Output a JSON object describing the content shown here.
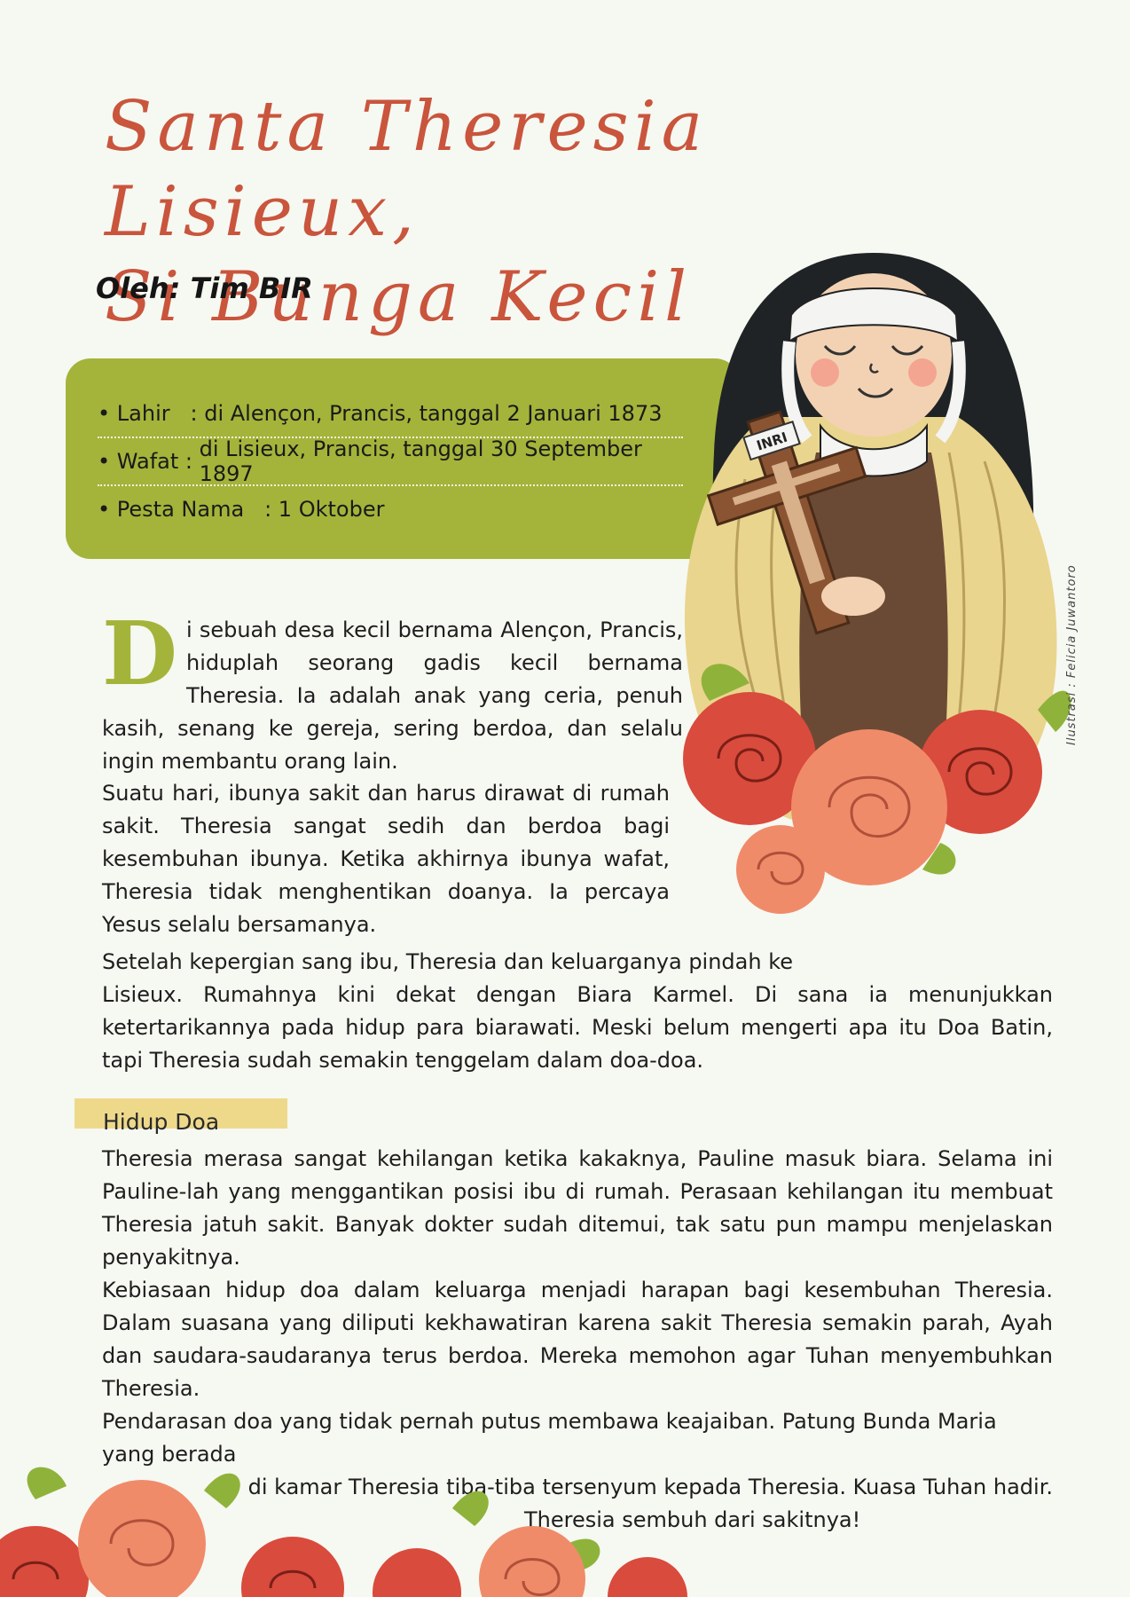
{
  "title_lines": [
    "Santa Theresia Lisieux,",
    "Si Bunga Kecil"
  ],
  "byline": "Oleh: Tim BIR",
  "info": [
    {
      "label": "Lahir",
      "sep": "   : ",
      "value": "di Alençon, Prancis, tanggal 2 Januari 1873"
    },
    {
      "label": "Wafat",
      "sep": " : ",
      "value": "di Lisieux, Prancis, tanggal 30 September 1897"
    },
    {
      "label": "Pesta Nama",
      "sep": "   : ",
      "value": "1 Oktober"
    }
  ],
  "illustration": {
    "credit": "Ilustrasi : Felicia Juwantoro",
    "cross_label": "INRI",
    "colors": {
      "rose_red": "#d94b3c",
      "rose_pink": "#f08b6a",
      "leaf": "#8fb33a",
      "habit_brown": "#6b4a35",
      "cloak": "#ead58e",
      "veil": "#1f2326"
    }
  },
  "article": {
    "dropcap": "D",
    "p1": "i sebuah desa kecil bernama Alençon, Prancis, hiduplah seorang gadis kecil bernama Theresia. Ia adalah anak yang ceria, penuh kasih, senang ke gereja, sering berdoa, dan selalu ingin membantu orang lain.",
    "p2": "Suatu hari, ibunya sakit dan harus dirawat di rumah sakit. Theresia sangat sedih dan berdoa bagi kesembuhan ibunya. Ketika akhirnya ibunya wafat, Theresia tidak menghentikan doanya. Ia percaya Yesus selalu bersamanya.",
    "p3_first": "Setelah kepergian sang ibu, Theresia dan keluarganya pindah ke",
    "p3_rest": "Lisieux. Rumahnya kini dekat dengan Biara Karmel. Di sana ia menunjukkan ketertarikannya pada hidup para biarawati. Meski belum mengerti apa itu Doa Batin, tapi Theresia sudah semakin tenggelam dalam doa-doa.",
    "subheading": "Hidup Doa",
    "p4": "Theresia merasa sangat kehilangan ketika kakaknya, Pauline masuk biara. Selama ini Pauline-lah yang menggantikan posisi ibu di rumah. Perasaan kehilangan itu membuat Theresia jatuh sakit. Banyak dokter sudah ditemui, tak satu pun mampu menjelaskan penyakitnya.",
    "p5": "Kebiasaan hidup doa dalam keluarga menjadi harapan bagi kesembuhan Theresia. Dalam suasana yang diliputi kekhawatiran karena sakit Theresia semakin parah, Ayah dan saudara-saudaranya terus berdoa. Mereka memohon agar Tuhan menyembuhkan Theresia.",
    "p6_line1": "Pendarasan doa yang tidak pernah putus membawa keajaiban. Patung Bunda Maria yang berada",
    "p6_line2": "di kamar Theresia tiba-tiba tersenyum kepada Theresia. Kuasa Tuhan  hadir.",
    "p6_line3": "Theresia sembuh dari sakitnya!"
  }
}
